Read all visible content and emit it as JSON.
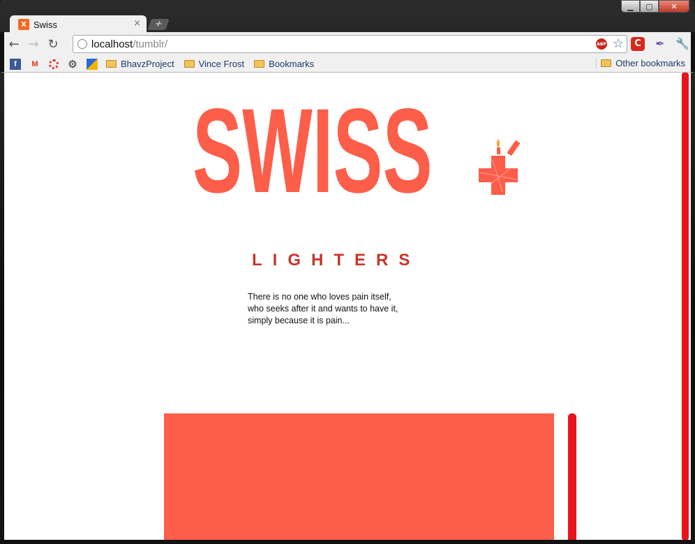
{
  "window": {
    "controls": {
      "minimize": "▁",
      "maximize": "▢",
      "close": "✕"
    }
  },
  "tab": {
    "title": "Swiss",
    "favicon": "X",
    "close": "×",
    "new_tab": "+"
  },
  "toolbar": {
    "back": "←",
    "forward": "→",
    "reload": "↻",
    "url_host": "localhost",
    "url_path": "/tumblr/",
    "abp_label": "ABP",
    "star": "☆",
    "ext_c": "C",
    "ext_quill": "✒",
    "wrench": "🔧"
  },
  "bookmarks": {
    "icons": [
      "facebook-icon",
      "gmail-icon",
      "ring-icon",
      "gear-icon",
      "cube-icon"
    ],
    "fb": "f",
    "gmail": "M",
    "gear": "⚙",
    "folders": [
      "BhavzProject",
      "Vince Frost",
      "Bookmarks"
    ],
    "other": "Other bookmarks"
  },
  "page": {
    "logo": "SWISS",
    "subtitle": "LIGHTERS",
    "intro": "There is no one who loves pain itself, who seeks after it and wants to have it, simply because it is pain..."
  },
  "colors": {
    "brand": "#fd5e49",
    "brand_dark": "#c6372a",
    "scrollbar": "#e8141c"
  }
}
